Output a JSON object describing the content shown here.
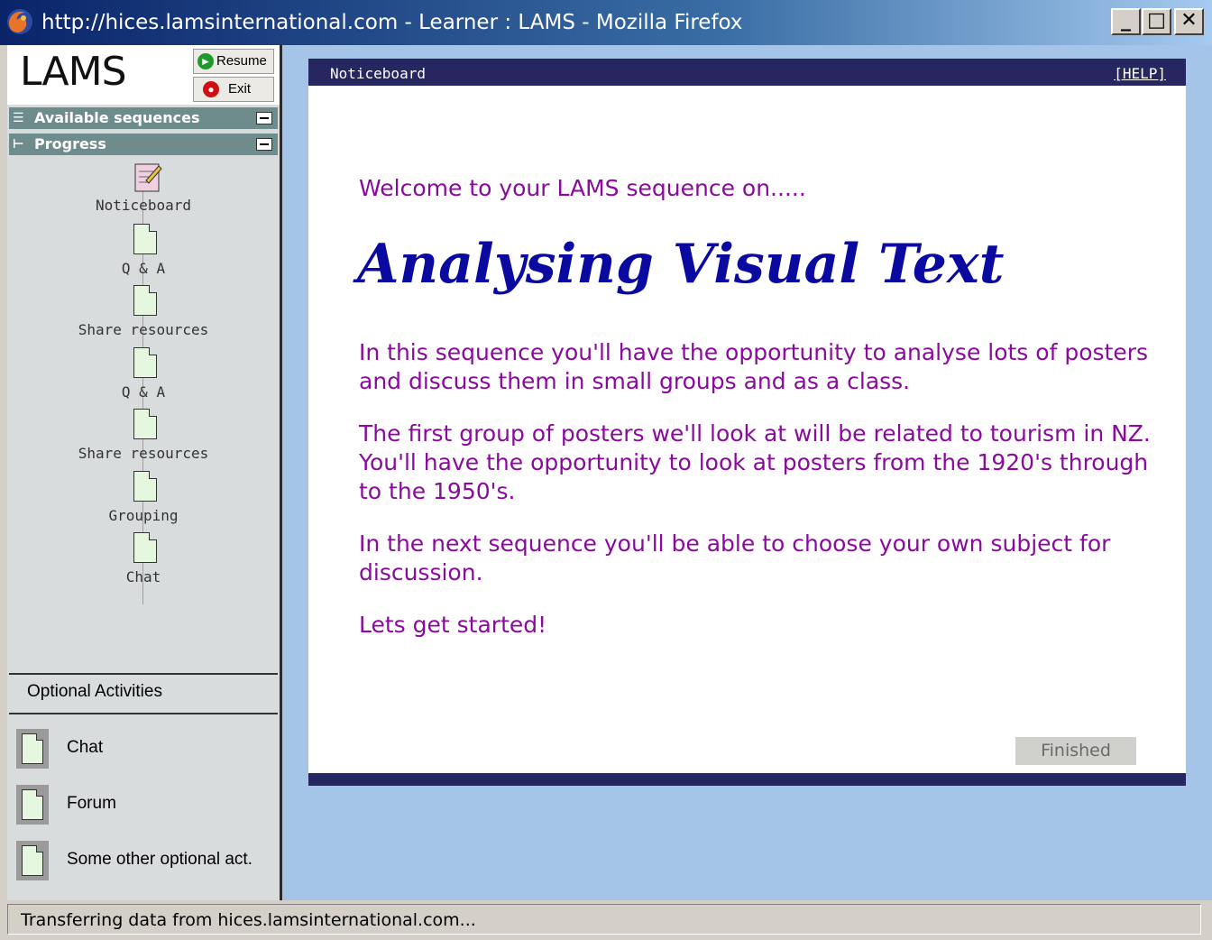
{
  "window": {
    "title": "http://hices.lamsinternational.com - Learner : LAMS - Mozilla Firefox",
    "minimize_label": "_",
    "maximize_label": "□",
    "close_label": "✕"
  },
  "sidebar": {
    "logo": "LAMS",
    "resume_label": "Resume",
    "exit_label": "Exit",
    "available_sequences_label": "Available sequences",
    "progress_label": "Progress",
    "progress_items": [
      {
        "label": "Noticeboard",
        "icon": "noticeboard-icon"
      },
      {
        "label": "Q & A",
        "icon": "document-icon"
      },
      {
        "label": "Share resources",
        "icon": "document-icon"
      },
      {
        "label": "Q & A",
        "icon": "document-icon"
      },
      {
        "label": "Share resources",
        "icon": "document-icon"
      },
      {
        "label": "Grouping",
        "icon": "document-icon"
      },
      {
        "label": "Chat",
        "icon": "document-icon"
      }
    ],
    "optional_header": "Optional Activities",
    "optional_items": [
      {
        "label": "Chat"
      },
      {
        "label": "Forum"
      },
      {
        "label": "Some other optional act."
      }
    ]
  },
  "main": {
    "panel_title": "Noticeboard",
    "help_label": "[HELP]",
    "welcome": "Welcome to your LAMS sequence on.....",
    "heading": "Analysing Visual Text",
    "paragraph1": "In this sequence you'll have the opportunity to analyse lots of posters and discuss them in small groups and as a class.",
    "paragraph2": "The first group of posters we'll look at will be related to tourism in NZ. You'll have the opportunity to look at posters from the 1920's through to the 1950's.",
    "paragraph3": "In the next sequence you'll be able to choose your own subject for discussion.",
    "paragraph4": "Lets get started!",
    "finished_label": "Finished"
  },
  "status": {
    "text": "Transferring data from hices.lamsinternational.com..."
  },
  "colors": {
    "content_text": "#8a0a9e",
    "heading": "#0a0aa0",
    "panel_bar": "#262660",
    "background": "#a4c5e8"
  }
}
